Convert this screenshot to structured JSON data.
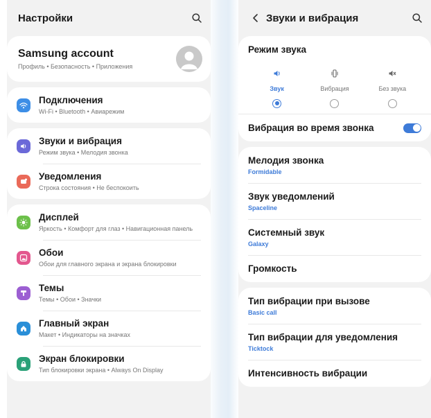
{
  "left": {
    "title": "Настройки",
    "account": {
      "title": "Samsung account",
      "subtitle": "Профиль • Безопасность • Приложения"
    },
    "groups": [
      [
        {
          "title": "Подключения",
          "subtitle": "Wi-Fi • Bluetooth • Авиарежим",
          "icon": "wifi-icon",
          "color": "#3d8ee6"
        }
      ],
      [
        {
          "title": "Звуки и вибрация",
          "subtitle": "Режим звука • Мелодия звонка",
          "icon": "volume-icon",
          "color": "#6b69d8"
        },
        {
          "title": "Уведомления",
          "subtitle": "Строка состояния • Не беспокоить",
          "icon": "notification-icon",
          "color": "#ea6a59"
        }
      ],
      [
        {
          "title": "Дисплей",
          "subtitle": "Яркость • Комфорт для глаз • Навигационная панель",
          "icon": "brightness-icon",
          "color": "#6cc04a"
        },
        {
          "title": "Обои",
          "subtitle": "Обои для главного экрана и экрана блокировки",
          "icon": "wallpaper-icon",
          "color": "#e3578e"
        },
        {
          "title": "Темы",
          "subtitle": "Темы • Обои • Значки",
          "icon": "themes-icon",
          "color": "#9c5fd2"
        },
        {
          "title": "Главный экран",
          "subtitle": "Макет • Индикаторы на значках",
          "icon": "home-icon",
          "color": "#2a8fd8"
        },
        {
          "title": "Экран блокировки",
          "subtitle": "Тип блокировки экрана • Always On Display",
          "icon": "lock-icon",
          "color": "#2aa178"
        }
      ]
    ]
  },
  "right": {
    "title": "Звуки и вибрация",
    "sound_mode": {
      "title": "Режим звука",
      "options": [
        {
          "label": "Звук",
          "icon": "volume-icon",
          "selected": true
        },
        {
          "label": "Вибрация",
          "icon": "vibrate-icon",
          "selected": false
        },
        {
          "label": "Без звука",
          "icon": "mute-icon",
          "selected": false
        }
      ]
    },
    "vibrate_while_ringing": {
      "label": "Вибрация во время звонка",
      "on": true
    },
    "sound_items": [
      {
        "title": "Мелодия звонка",
        "value": "Formidable"
      },
      {
        "title": "Звук уведомлений",
        "value": "Spaceline"
      },
      {
        "title": "Системный звук",
        "value": "Galaxy"
      },
      {
        "title": "Громкость",
        "value": ""
      }
    ],
    "vibration_items": [
      {
        "title": "Тип вибрации при вызове",
        "value": "Basic call"
      },
      {
        "title": "Тип вибрации для уведомления",
        "value": "Ticktock"
      },
      {
        "title": "Интенсивность вибрации",
        "value": ""
      }
    ]
  },
  "colors": {
    "accent": "#3e7bd8",
    "background": "#f2f2f2",
    "card": "#ffffff"
  }
}
